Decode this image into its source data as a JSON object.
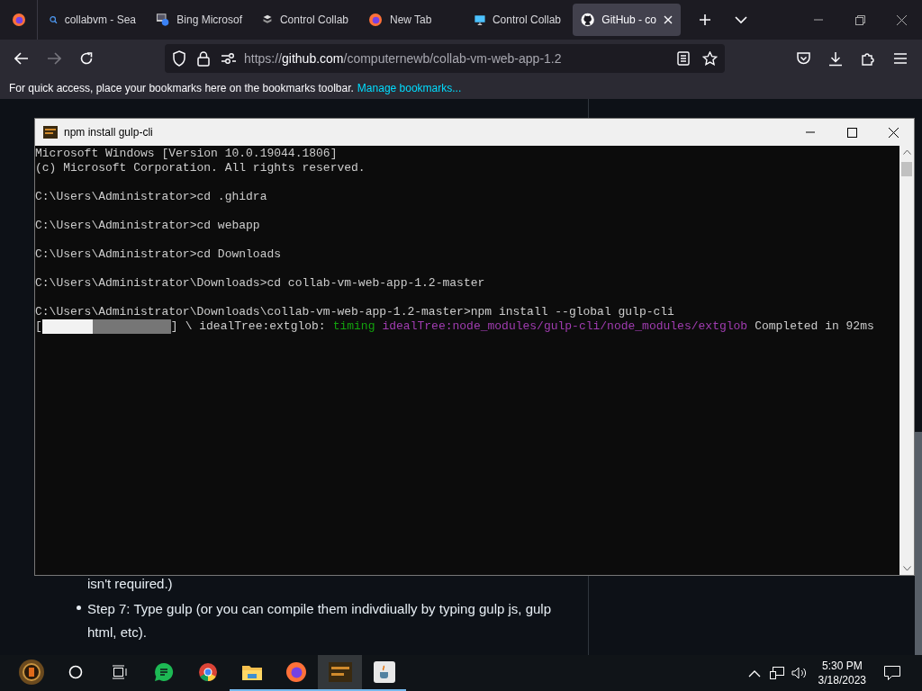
{
  "browser": {
    "tabs": [
      {
        "title": "collabvm - Sea",
        "kind": "search",
        "selected": false
      },
      {
        "title": "Bing Microsof",
        "kind": "window",
        "selected": false
      },
      {
        "title": "Control Collab",
        "kind": "server",
        "selected": false
      },
      {
        "title": "New Tab",
        "kind": "browser",
        "selected": false
      },
      {
        "title": "Control Collab",
        "kind": "monitor",
        "selected": false
      },
      {
        "title": "GitHub - co",
        "kind": "cat",
        "selected": true
      }
    ],
    "url": {
      "scheme": "https://",
      "host": "github.com",
      "path": "/computernewb/collab-vm-web-app-1.2"
    },
    "bookmarks_bar": {
      "text": "For quick access, place your bookmarks here on the bookmarks toolbar.",
      "link": "Manage bookmarks..."
    }
  },
  "page": {
    "lines": [
      {
        "bullet": false,
        "text": "isn't required.)"
      },
      {
        "bullet": true,
        "text": "Step 7: Type gulp (or you can compile them indivdiually by typing gulp js, gulp html, etc)."
      }
    ]
  },
  "terminal": {
    "title": "npm install gulp-cli",
    "lines": [
      {
        "kind": "text",
        "segments": [
          {
            "color": "#cccccc",
            "text": "Microsoft Windows [Version 10.0.19044.1806]"
          }
        ]
      },
      {
        "kind": "text",
        "segments": [
          {
            "color": "#cccccc",
            "text": "(c) Microsoft Corporation. All rights reserved."
          }
        ]
      },
      {
        "kind": "blank"
      },
      {
        "kind": "text",
        "segments": [
          {
            "color": "#cccccc",
            "text": "C:\\Users\\Administrator>cd .ghidra"
          }
        ]
      },
      {
        "kind": "blank"
      },
      {
        "kind": "text",
        "segments": [
          {
            "color": "#cccccc",
            "text": "C:\\Users\\Administrator>cd webapp"
          }
        ]
      },
      {
        "kind": "blank"
      },
      {
        "kind": "text",
        "segments": [
          {
            "color": "#cccccc",
            "text": "C:\\Users\\Administrator>cd Downloads"
          }
        ]
      },
      {
        "kind": "blank"
      },
      {
        "kind": "text",
        "segments": [
          {
            "color": "#cccccc",
            "text": "C:\\Users\\Administrator\\Downloads>cd collab-vm-web-app-1.2-master"
          }
        ]
      },
      {
        "kind": "blank"
      },
      {
        "kind": "text",
        "segments": [
          {
            "color": "#cccccc",
            "text": "C:\\Users\\Administrator\\Downloads\\collab-vm-web-app-1.2-master>npm install --global gulp-cli"
          }
        ]
      },
      {
        "kind": "progress",
        "open": "[",
        "close": "]",
        "level": 0.39,
        "segments": [
          {
            "color": "#cccccc",
            "text": "\\ idealTree:extglob:"
          },
          {
            "color": "#13a10e",
            "text": "timing"
          },
          {
            "color": "#a03cb0",
            "text": "idealTree:node_modules/gulp-cli/node_modules/extglob"
          },
          {
            "color": "#cccccc",
            "text": "Completed in 92ms"
          }
        ]
      }
    ]
  },
  "taskbar": {
    "apps": [
      {
        "kind": "emblem",
        "active": false
      },
      {
        "kind": "search",
        "active": false
      },
      {
        "kind": "task-view",
        "active": false
      },
      {
        "kind": "chat",
        "active": false
      },
      {
        "kind": "chrome",
        "active": false
      },
      {
        "kind": "folder",
        "active": true
      },
      {
        "kind": "browser",
        "active": true
      },
      {
        "kind": "terminal",
        "active": true
      },
      {
        "kind": "cup",
        "active": true
      }
    ],
    "time": "5:30 PM",
    "date": "3/18/2023"
  }
}
